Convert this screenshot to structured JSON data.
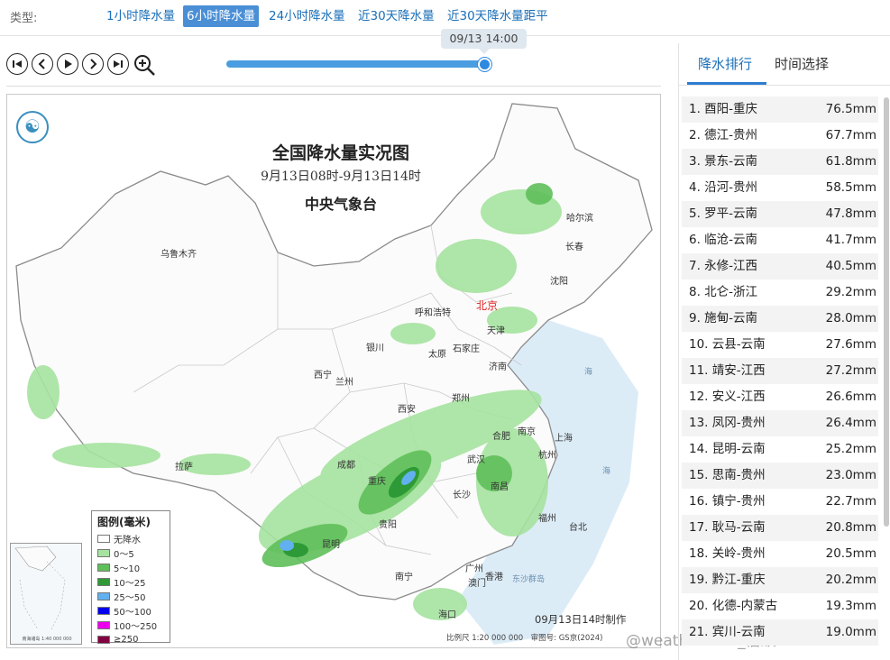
{
  "type_bar": {
    "label": "类型:",
    "tabs": [
      "1小时降水量",
      "6小时降水量",
      "24小时降水量",
      "近30天降水量",
      "近30天降水量距平"
    ],
    "active_index": 1
  },
  "controls": {
    "icons": [
      "skip-first-icon",
      "prev-icon",
      "play-icon",
      "next-icon",
      "skip-last-icon",
      "zoom-in-icon"
    ]
  },
  "slider": {
    "time_label": "09/13 14:00",
    "progress": 1.0
  },
  "map": {
    "title": "全国降水量实况图",
    "subtitle": "9月13日08时-9月13日14时",
    "org": "中央气象台",
    "capital": "北京",
    "cities": [
      "乌鲁木齐",
      "哈尔滨",
      "长春",
      "沈阳",
      "呼和浩特",
      "天津",
      "银川",
      "太原",
      "石家庄",
      "济南",
      "西宁",
      "兰州",
      "郑州",
      "西安",
      "拉萨",
      "成都",
      "合肥",
      "南京",
      "上海",
      "武汉",
      "杭州",
      "重庆",
      "长沙",
      "南昌",
      "贵阳",
      "福州",
      "台北",
      "昆明",
      "南宁",
      "广州",
      "香港",
      "澳门",
      "海口"
    ],
    "legend_title": "图例(毫米)",
    "legend": [
      {
        "label": "无降水",
        "color": "#ffffff"
      },
      {
        "label": "0～5",
        "color": "#a6e3a0"
      },
      {
        "label": "5～10",
        "color": "#5fbf5a"
      },
      {
        "label": "10～25",
        "color": "#2e9a37"
      },
      {
        "label": "25～50",
        "color": "#62b0f0"
      },
      {
        "label": "50～100",
        "color": "#0000ee"
      },
      {
        "label": "100～250",
        "color": "#ee00ee"
      },
      {
        "label": "≥250",
        "color": "#800040"
      }
    ],
    "made_label": "09月13日14时制作",
    "scale_label": "比例尺 1:20 000 000　审图号: GS京(2024)",
    "inset_caption": "南海诸岛 1:40 000 000"
  },
  "watermark": "@weatherman_信欣",
  "panel": {
    "tabs": [
      "降水排行",
      "时间选择"
    ],
    "active_tab": 0,
    "ranking": [
      {
        "name": "1. 酉阳-重庆",
        "value": "76.5mm"
      },
      {
        "name": "2. 德江-贵州",
        "value": "67.7mm"
      },
      {
        "name": "3. 景东-云南",
        "value": "61.8mm"
      },
      {
        "name": "4. 沿河-贵州",
        "value": "58.5mm"
      },
      {
        "name": "5. 罗平-云南",
        "value": "47.8mm"
      },
      {
        "name": "6. 临沧-云南",
        "value": "41.7mm"
      },
      {
        "name": "7. 永修-江西",
        "value": "40.5mm"
      },
      {
        "name": "8. 北仑-浙江",
        "value": "29.2mm"
      },
      {
        "name": "9. 施甸-云南",
        "value": "28.0mm"
      },
      {
        "name": "10. 云县-云南",
        "value": "27.6mm"
      },
      {
        "name": "11. 靖安-江西",
        "value": "27.2mm"
      },
      {
        "name": "12. 安义-江西",
        "value": "26.6mm"
      },
      {
        "name": "13. 凤冈-贵州",
        "value": "26.4mm"
      },
      {
        "name": "14. 昆明-云南",
        "value": "25.2mm"
      },
      {
        "name": "15. 思南-贵州",
        "value": "23.0mm"
      },
      {
        "name": "16. 镇宁-贵州",
        "value": "22.7mm"
      },
      {
        "name": "17. 耿马-云南",
        "value": "20.8mm"
      },
      {
        "name": "18. 关岭-贵州",
        "value": "20.5mm"
      },
      {
        "name": "19. 黔江-重庆",
        "value": "20.2mm"
      },
      {
        "name": "20. 化德-内蒙古",
        "value": "19.3mm"
      },
      {
        "name": "21. 宾川-云南",
        "value": "19.0mm"
      }
    ]
  }
}
